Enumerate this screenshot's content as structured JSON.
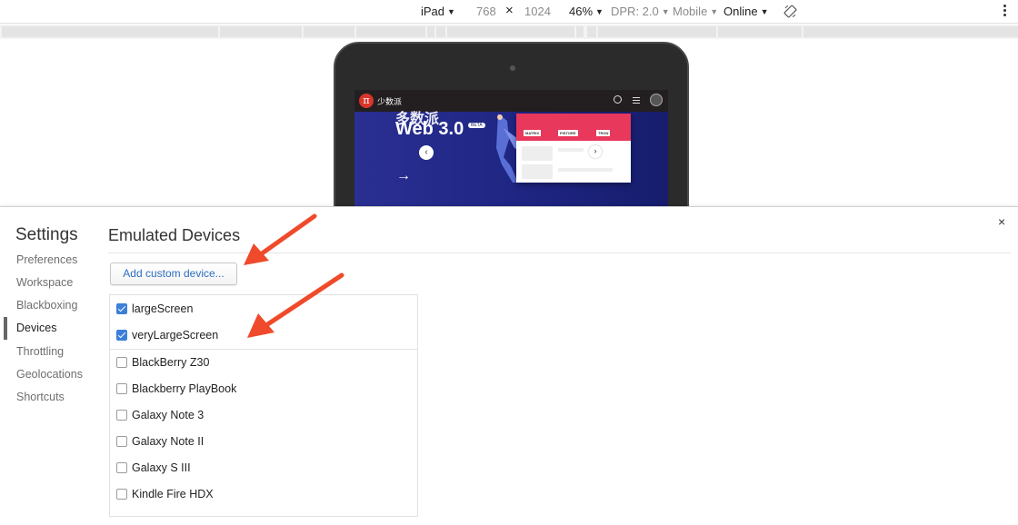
{
  "toolbar": {
    "device": "iPad",
    "width": "768",
    "times": "×",
    "height": "1024",
    "zoom": "46%",
    "dpr": "DPR: 2.0",
    "ua": "Mobile",
    "throttle": "Online"
  },
  "preview": {
    "site_name": "少数派",
    "logo_glyph": "π",
    "hero_line1": "多数派",
    "hero_title": "Web 3.0",
    "hero_badge": "BETA",
    "tabs": [
      "MATRIX",
      "PISTORE",
      "TRON"
    ],
    "prev_glyph": "‹",
    "next_glyph": "›",
    "arrow_glyph": "→"
  },
  "settings": {
    "title": "Settings",
    "close": "×",
    "nav": [
      {
        "label": "Preferences"
      },
      {
        "label": "Workspace"
      },
      {
        "label": "Blackboxing"
      },
      {
        "label": "Devices",
        "active": true
      },
      {
        "label": "Throttling"
      },
      {
        "label": "Geolocations"
      },
      {
        "label": "Shortcuts"
      }
    ],
    "section_title": "Emulated Devices",
    "add_button": "Add custom device...",
    "devices": [
      {
        "label": "largeScreen",
        "checked": true
      },
      {
        "label": "veryLargeScreen",
        "checked": true
      },
      {
        "label": "BlackBerry Z30",
        "checked": false
      },
      {
        "label": "Blackberry PlayBook",
        "checked": false
      },
      {
        "label": "Galaxy Note 3",
        "checked": false
      },
      {
        "label": "Galaxy Note II",
        "checked": false
      },
      {
        "label": "Galaxy S III",
        "checked": false
      },
      {
        "label": "Kindle Fire HDX",
        "checked": false
      }
    ]
  },
  "colors": {
    "accent": "#3b7fd9",
    "annotation_arrow": "#ef4a2b",
    "hero_bg": "#1d2376",
    "panel_pink": "#e8385c"
  },
  "icons": {
    "rotate": "rotate-icon",
    "more": "more-vert-icon",
    "close": "close-icon",
    "caret": "caret-down-icon"
  }
}
